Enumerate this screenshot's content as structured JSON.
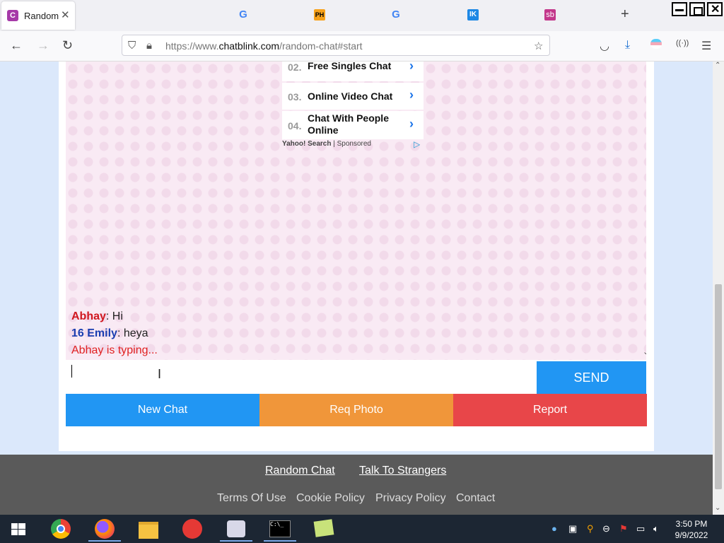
{
  "browser": {
    "active_tab": {
      "title": "Random c",
      "favicon_letter": "C"
    },
    "other_tabs": [
      "G",
      "PH",
      "G",
      "IK",
      "sb"
    ],
    "url_domain_prefix": "https://www.",
    "url_domain": "chatblink.com",
    "url_path": "/random-chat#start"
  },
  "ad": {
    "items": [
      {
        "num": "02.",
        "label": "Free Singles Chat"
      },
      {
        "num": "03.",
        "label": "Online Video Chat"
      },
      {
        "num": "04.",
        "label": "Chat With People Online"
      }
    ],
    "footer_brand": "Yahoo! Search",
    "footer_sep": " | ",
    "footer_sponsored": "Sponsored"
  },
  "chat": {
    "messages": [
      {
        "name": "Abhay",
        "text": ": Hi"
      },
      {
        "name": "16 Emily",
        "text": ": heya"
      }
    ],
    "typing": "Abhay is typing..."
  },
  "composer": {
    "value": "",
    "send_label": "SEND"
  },
  "actions": {
    "new_chat": "New Chat",
    "req_photo": "Req Photo",
    "report": "Report"
  },
  "colors": {
    "send": "#2196f3",
    "new_chat": "#2196f3",
    "req_photo": "#f0963a",
    "report": "#e84649"
  },
  "footer": {
    "top_links": [
      "Random Chat",
      "Talk To Strangers"
    ],
    "bottom_links": [
      "Terms Of Use",
      "Cookie Policy",
      "Privacy Policy",
      "Contact"
    ]
  },
  "taskbar": {
    "time": "3:50 PM",
    "date": "9/9/2022"
  }
}
